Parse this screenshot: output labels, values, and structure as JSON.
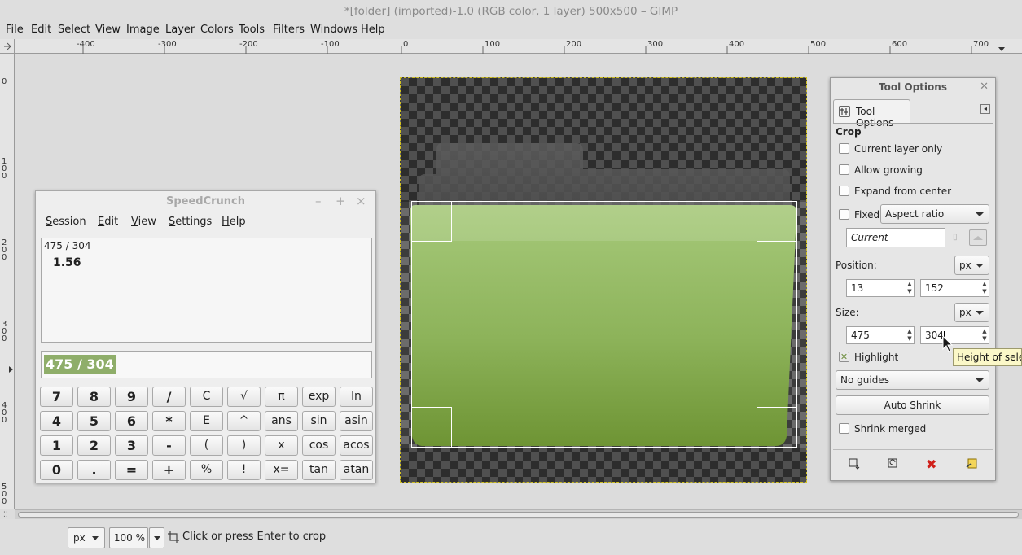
{
  "window": {
    "title": "*[folder] (imported)-1.0 (RGB color, 1 layer) 500x500 – GIMP"
  },
  "menubar": {
    "items": [
      "File",
      "Edit",
      "Select",
      "View",
      "Image",
      "Layer",
      "Colors",
      "Tools",
      "Filters",
      "Windows",
      "Help"
    ]
  },
  "rulers": {
    "horizontal": [
      "-400",
      "-300",
      "-200",
      "-100",
      "0",
      "100",
      "200",
      "300",
      "400",
      "500",
      "600",
      "700"
    ],
    "vertical": [
      "0",
      "100",
      "200",
      "300",
      "400",
      "500"
    ]
  },
  "speedcrunch": {
    "title": "SpeedCrunch",
    "controls": [
      "–",
      "+",
      "×"
    ],
    "menu": [
      {
        "ul": "S",
        "rest": "ession"
      },
      {
        "ul": "E",
        "rest": "dit"
      },
      {
        "ul": "V",
        "rest": "iew"
      },
      {
        "ul": "S",
        "rest": "ettings"
      },
      {
        "ul": "H",
        "rest": "elp"
      }
    ],
    "history_expression": "475 / 304",
    "history_result": "1.56",
    "input_value": "475 / 304",
    "keys": [
      [
        "7",
        "8",
        "9",
        "/",
        "C",
        "√",
        "π",
        "exp",
        "ln"
      ],
      [
        "4",
        "5",
        "6",
        "*",
        "E",
        "^",
        "ans",
        "sin",
        "asin"
      ],
      [
        "1",
        "2",
        "3",
        "-",
        "(",
        ")",
        "x",
        "cos",
        "acos"
      ],
      [
        "0",
        ".",
        "=",
        "+",
        "%",
        "!",
        "x=",
        "tan",
        "atan"
      ]
    ]
  },
  "tool_options": {
    "title": "Tool Options",
    "tab_label": "Tool Options",
    "section": "Crop",
    "current_layer_only": "Current layer only",
    "allow_growing": "Allow growing",
    "expand_from_center": "Expand from center",
    "fixed_label": "Fixed:",
    "fixed_mode": "Aspect ratio",
    "ratio_value": "Current",
    "position_label": "Position:",
    "position_unit": "px",
    "position_x": "13",
    "position_y": "152",
    "size_label": "Size:",
    "size_unit": "px",
    "size_w": "475",
    "size_h": "304",
    "highlight": "Highlight",
    "guides": "No guides",
    "auto_shrink": "Auto Shrink",
    "shrink_merged": "Shrink merged"
  },
  "tooltip": {
    "text": "Height of selec"
  },
  "statusbar": {
    "unit": "px",
    "zoom": "100 %",
    "message": "Click or press Enter to crop"
  },
  "colors": {
    "folder_green": "#8db35a",
    "folder_grey": "#777777",
    "checker_dark": "#3c3c3c",
    "selection_bg": "#8fae6a"
  }
}
